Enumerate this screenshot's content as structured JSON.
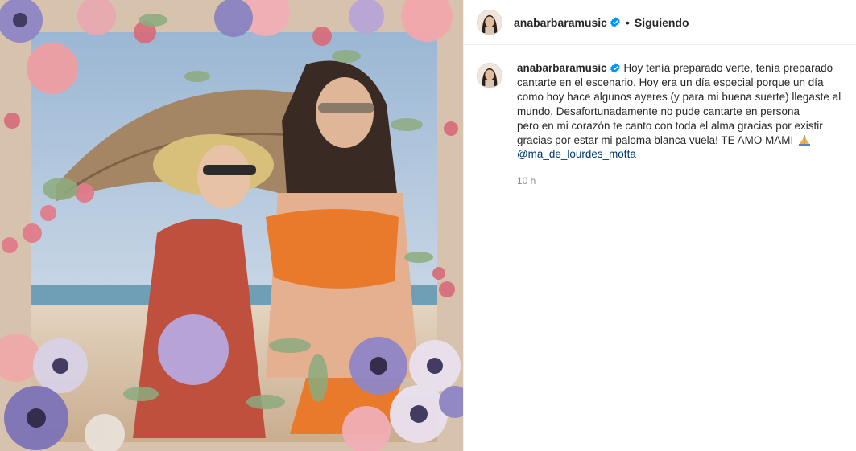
{
  "post": {
    "username": "anabarbaramusic",
    "separator": "•",
    "follow_label": "Siguiendo",
    "caption_lines": [
      "Hoy tenía preparado verte, tenía preparado",
      "cantarte en el escenario. Hoy era un día especial porque un día",
      "como hoy hace algunos ayeres (y para mi buena suerte) llegaste al",
      "mundo. Desafortunadamente no pude cantarte en persona",
      "pero en mi corazón te canto con toda el alma gracias por existir",
      "gracias por estar mi paloma blanca vuela! TE AMO MAMI"
    ],
    "mention": "@ma_de_lourdes_motta",
    "timestamp": "10 h"
  },
  "icons": {
    "verified": "verified-badge-icon",
    "praying_hands": "praying-hands-emoji"
  },
  "colors": {
    "verified_blue": "#0095f6",
    "mention_blue": "#00376b",
    "muted_gray": "#8e8e8e"
  }
}
